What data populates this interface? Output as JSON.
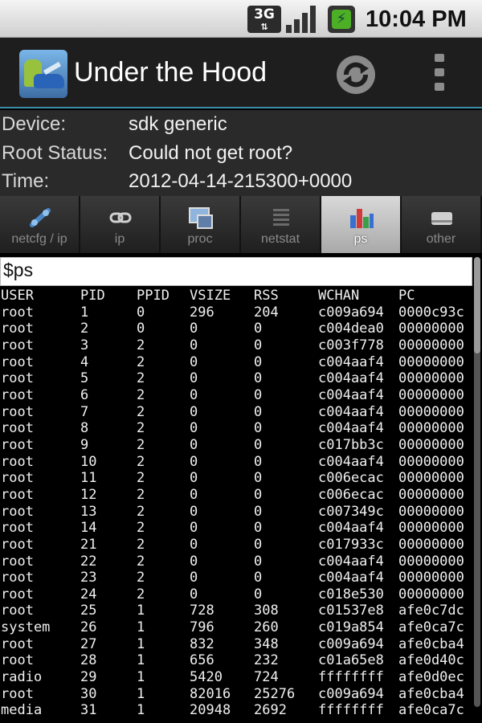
{
  "status_bar": {
    "network": "3G",
    "time": "10:04 PM"
  },
  "title_bar": {
    "title": "Under the Hood",
    "icons": [
      "app-icon",
      "refresh-icon",
      "overflow-menu-icon"
    ]
  },
  "info": {
    "device_label": "Device:",
    "device_value": "sdk generic",
    "root_label": "Root Status:",
    "root_value": "Could not get root?",
    "time_label": "Time:",
    "time_value": "2012-04-14-215300+0000"
  },
  "tabs": [
    {
      "label": "netcfg / ip",
      "icon": "network-icon"
    },
    {
      "label": "ip",
      "icon": "link-icon"
    },
    {
      "label": "proc",
      "icon": "processor-icon"
    },
    {
      "label": "netstat",
      "icon": "list-icon"
    },
    {
      "label": "ps",
      "icon": "bar-chart-icon",
      "active": true
    },
    {
      "label": "other",
      "icon": "drive-icon"
    }
  ],
  "command": "$ps",
  "table": {
    "headers": [
      "USER",
      "PID",
      "PPID",
      "VSIZE",
      "RSS",
      "WCHAN",
      "PC"
    ],
    "rows": [
      [
        "root",
        "1",
        "0",
        "296",
        "204",
        "c009a694",
        "0000c93c"
      ],
      [
        "root",
        "2",
        "0",
        "0",
        "0",
        "c004dea0",
        "00000000"
      ],
      [
        "root",
        "3",
        "2",
        "0",
        "0",
        "c003f778",
        "00000000"
      ],
      [
        "root",
        "4",
        "2",
        "0",
        "0",
        "c004aaf4",
        "00000000"
      ],
      [
        "root",
        "5",
        "2",
        "0",
        "0",
        "c004aaf4",
        "00000000"
      ],
      [
        "root",
        "6",
        "2",
        "0",
        "0",
        "c004aaf4",
        "00000000"
      ],
      [
        "root",
        "7",
        "2",
        "0",
        "0",
        "c004aaf4",
        "00000000"
      ],
      [
        "root",
        "8",
        "2",
        "0",
        "0",
        "c004aaf4",
        "00000000"
      ],
      [
        "root",
        "9",
        "2",
        "0",
        "0",
        "c017bb3c",
        "00000000"
      ],
      [
        "root",
        "10",
        "2",
        "0",
        "0",
        "c004aaf4",
        "00000000"
      ],
      [
        "root",
        "11",
        "2",
        "0",
        "0",
        "c006ecac",
        "00000000"
      ],
      [
        "root",
        "12",
        "2",
        "0",
        "0",
        "c006ecac",
        "00000000"
      ],
      [
        "root",
        "13",
        "2",
        "0",
        "0",
        "c007349c",
        "00000000"
      ],
      [
        "root",
        "14",
        "2",
        "0",
        "0",
        "c004aaf4",
        "00000000"
      ],
      [
        "root",
        "21",
        "2",
        "0",
        "0",
        "c017933c",
        "00000000"
      ],
      [
        "root",
        "22",
        "2",
        "0",
        "0",
        "c004aaf4",
        "00000000"
      ],
      [
        "root",
        "23",
        "2",
        "0",
        "0",
        "c004aaf4",
        "00000000"
      ],
      [
        "root",
        "24",
        "2",
        "0",
        "0",
        "c018e530",
        "00000000"
      ],
      [
        "root",
        "25",
        "1",
        "728",
        "308",
        "c01537e8",
        "afe0c7dc"
      ],
      [
        "system",
        "26",
        "1",
        "796",
        "260",
        "c019a854",
        "afe0ca7c"
      ],
      [
        "root",
        "27",
        "1",
        "832",
        "348",
        "c009a694",
        "afe0cba4"
      ],
      [
        "root",
        "28",
        "1",
        "656",
        "232",
        "c01a65e8",
        "afe0d40c"
      ],
      [
        "radio",
        "29",
        "1",
        "5420",
        "724",
        "ffffffff",
        "afe0d0ec"
      ],
      [
        "root",
        "30",
        "1",
        "82016",
        "25276",
        "c009a694",
        "afe0cba4"
      ],
      [
        "media",
        "31",
        "1",
        "20948",
        "2692",
        "ffffffff",
        "afe0ca7c"
      ]
    ]
  }
}
